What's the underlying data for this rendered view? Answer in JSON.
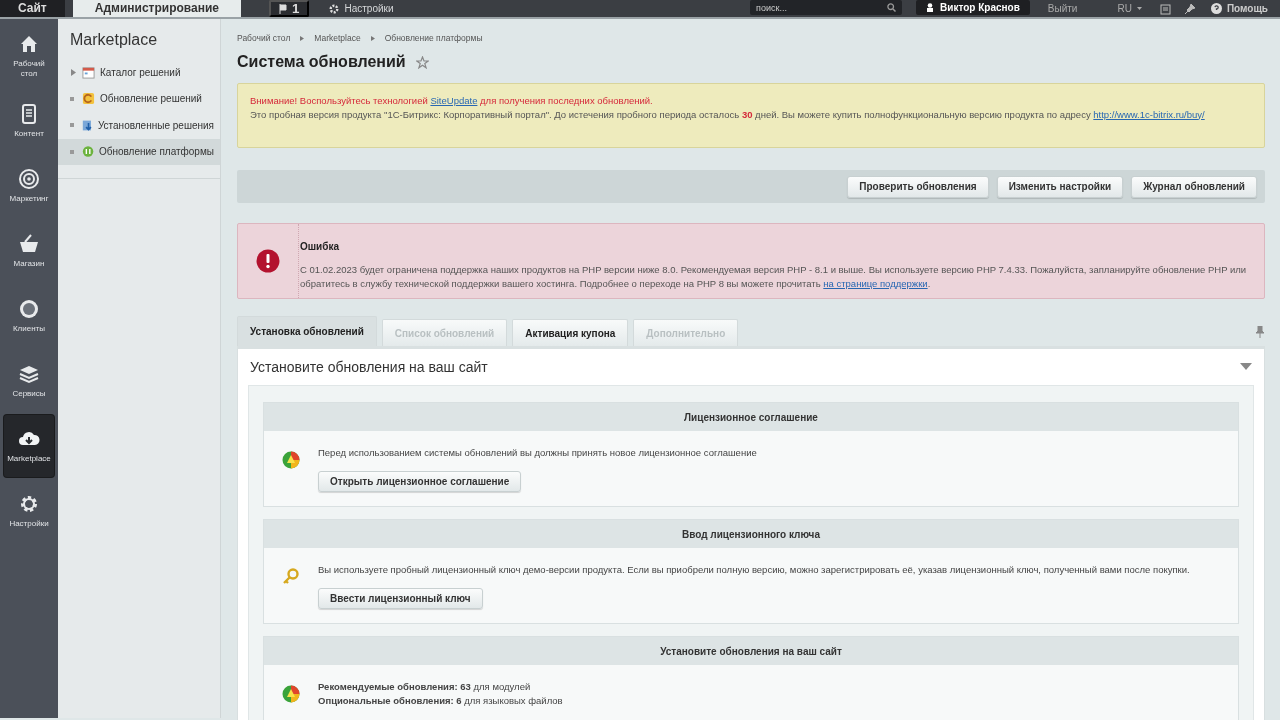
{
  "top_bar": {
    "tabs": [
      {
        "label": "Сайт",
        "selected": false
      },
      {
        "label": "Администрирование",
        "selected": true
      }
    ],
    "notifications_count": "1",
    "settings_label": "Настройки",
    "search": {
      "placeholder": "поиск..."
    },
    "user_name": "Виктор Краснов",
    "logout_label": "Выйти",
    "language": "RU",
    "help_label": "Помощь"
  },
  "rail": [
    {
      "label": "Рабочий стол",
      "selected": false
    },
    {
      "label": "Контент",
      "selected": false
    },
    {
      "label": "Маркетинг",
      "selected": false
    },
    {
      "label": "Магазин",
      "selected": false
    },
    {
      "label": "Клиенты",
      "selected": false
    },
    {
      "label": "Сервисы",
      "selected": false
    },
    {
      "label": "Marketplace",
      "selected": true
    },
    {
      "label": "Настройки",
      "selected": false
    }
  ],
  "sidebar": {
    "title": "Marketplace",
    "items": [
      {
        "label": "Каталог решений",
        "expanded": false,
        "kind": "folder",
        "selected": false
      },
      {
        "label": "Обновление решений",
        "kind": "leaf",
        "selected": false
      },
      {
        "label": "Установленные решения",
        "kind": "leaf",
        "selected": false
      },
      {
        "label": "Обновление платформы",
        "kind": "leaf",
        "selected": true
      }
    ]
  },
  "breadcrumbs": [
    "Рабочий стол",
    "Marketplace",
    "Обновление платформы"
  ],
  "page_title": "Система обновлений",
  "favorite": false,
  "notice": {
    "warning_before": "Внимание! Воспользуйтесь технологией ",
    "warning_link": "SiteUpdate",
    "warning_after": " для получения последних обновлений.",
    "text_before": "Это пробная версия продукта \"1С-Битрикс: Корпоративный портал\". До истечения пробного периода осталось ",
    "days": "30",
    "text_after": " дней. Вы можете купить полнофункциональную версию продукта по адресу ",
    "link": "http://www.1c-bitrix.ru/buy/"
  },
  "toolbar_buttons": [
    "Проверить обновления",
    "Изменить настройки",
    "Журнал обновлений"
  ],
  "error": {
    "title": "Ошибка",
    "text": "С 01.02.2023 будет ограничена поддержка наших продуктов на PHP версии ниже 8.0. Рекомендуемая версия PHP - 8.1 и выше. Вы используете версию PHP 7.4.33. Пожалуйста, запланируйте обновление PHP или обратитесь в службу технической поддержки вашего хостинга. Подробнее о переходе на PHP 8 вы можете прочитать ",
    "link": "на странице поддержки",
    "text_end": "."
  },
  "tabs": [
    {
      "label": "Установка обновлений",
      "selected": true,
      "disabled": false
    },
    {
      "label": "Список обновлений",
      "selected": false,
      "disabled": true
    },
    {
      "label": "Активация купона",
      "selected": false,
      "disabled": false
    },
    {
      "label": "Дополнительно",
      "selected": false,
      "disabled": true
    }
  ],
  "panel": {
    "title": "Установите обновления на ваш сайт",
    "expanded": true,
    "sections": [
      {
        "title": "Лицензионное соглашение",
        "kind": "globe",
        "lines": [
          "Перед использованием системы обновлений вы должны принять новое лицензионное соглашение"
        ],
        "button": "Открыть лицензионное соглашение"
      },
      {
        "title": "Ввод лицензионного ключа",
        "kind": "key",
        "lines": [
          "Вы используете пробный лицензионный ключ демо-версии продукта. Если вы приобрели полную версию, можно зарегистрировать её, указав лицензионный ключ, полученный вами после покупки."
        ],
        "button": "Ввести лицензионный ключ"
      },
      {
        "title": "Установите обновления на ваш сайт",
        "kind": "globe",
        "lines": [
          "**Рекомендуемые обновления: 63** для модулей",
          "**Опциональные обновления: 6** для языковых файлов"
        ]
      }
    ]
  }
}
